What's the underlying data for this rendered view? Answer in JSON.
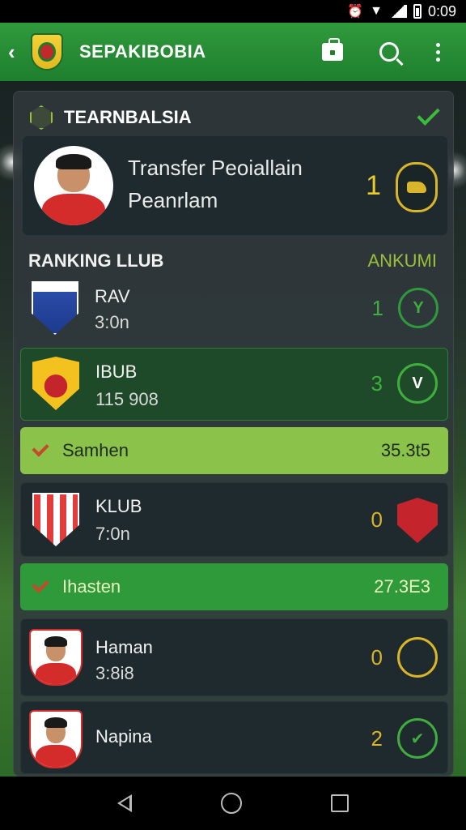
{
  "status_bar": {
    "time": "0:09",
    "alarm_icon": "alarm-icon",
    "wifi_icon": "wifi-icon",
    "signal_icon": "signal-icon",
    "battery_icon": "battery-icon"
  },
  "app_bar": {
    "title": "SEPAKIBOBIA",
    "back_icon": "back-arrow-icon",
    "logo_icon": "club-crest-logo",
    "actions": [
      "shop-bag-icon",
      "search-icon",
      "more-vert-icon"
    ]
  },
  "panel": {
    "title": "TEARNBALSIA",
    "header_icon": "shield-check-icon",
    "done_icon": "checkmark-icon",
    "featured": {
      "line1": "Transfer Peoiallain",
      "line2": "Peanrlam",
      "number": "1",
      "badge_icon": "trophy-hand-icon"
    },
    "ranking_label": "RANKING LLUB",
    "ranking_right": "ANKUMI",
    "rows": [
      {
        "name": "RAV",
        "value": "3:0n",
        "number": "1",
        "badge": "Y",
        "crest": "blue-crest",
        "number_color": "#3fae3f",
        "badge_color": "#2f9a3c"
      },
      {
        "name": "IBUB",
        "value": "115 908",
        "number": "3",
        "badge": "V",
        "crest": "yellow-crest",
        "number_color": "#3fae3f",
        "badge_color": "#3fae3f"
      },
      {
        "name": "KLUB",
        "value": "7:0n",
        "number": "0",
        "badge": "",
        "crest": "striped-crest",
        "number_color": "#d8b52a",
        "badge_color": "#c4242b"
      },
      {
        "name": "Haman",
        "value": "3:8i8",
        "number": "0",
        "badge": "",
        "crest": "player-photo",
        "number_color": "#d8b52a",
        "badge_color": "#d8b52a"
      },
      {
        "name": "Napina",
        "value": "",
        "number": "2",
        "badge": "✔",
        "crest": "player-photo",
        "number_color": "#d8b52a",
        "badge_color": "#3fae3f"
      }
    ],
    "summaries": [
      {
        "label": "Samhen",
        "value": "35.3t5",
        "bg": "#8bc34a",
        "text": "#1e2a1e"
      },
      {
        "label": "Ihasten",
        "value": "27.3E3",
        "bg": "#2e9a3a",
        "text": "#e9f5c0"
      }
    ]
  },
  "nav_bar": {
    "back": "nav-back-icon",
    "home": "nav-home-icon",
    "recents": "nav-recents-icon"
  }
}
